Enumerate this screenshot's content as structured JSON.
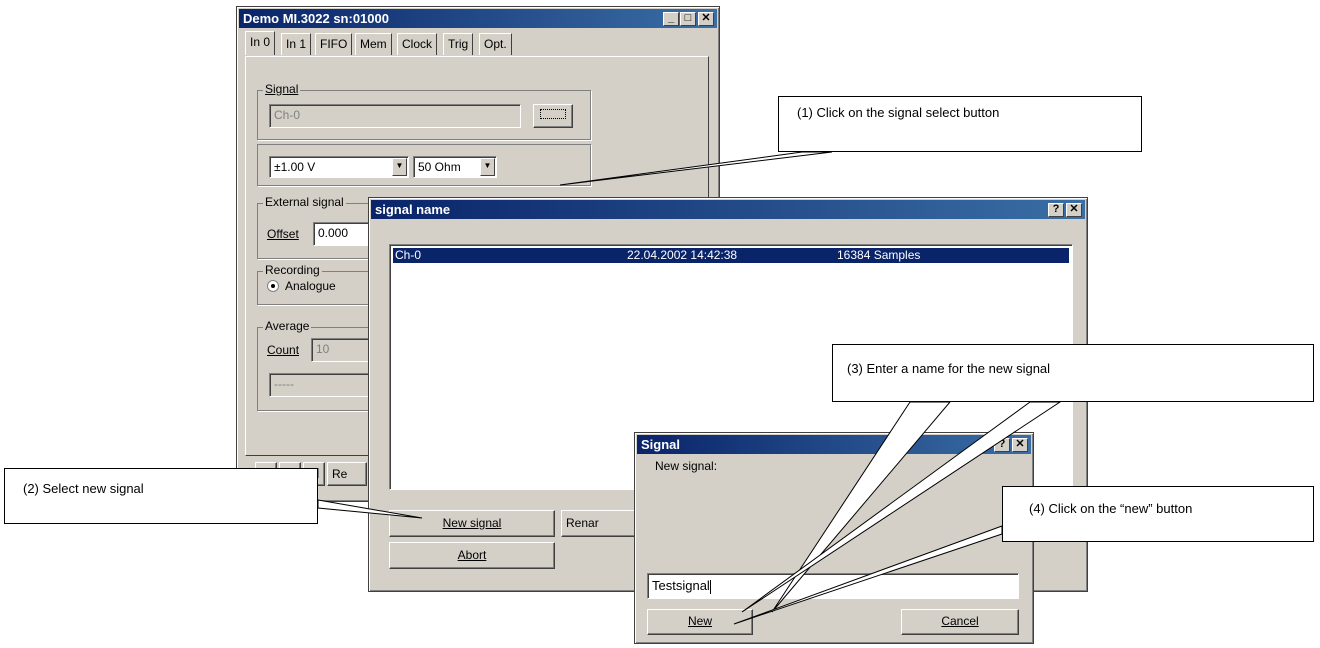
{
  "main_window": {
    "title": "Demo MI.3022 sn:01000",
    "tabs": [
      "In 0",
      "In 1",
      "FIFO",
      "Mem",
      "Clock",
      "Trig",
      "Opt."
    ],
    "signal_group": "Signal",
    "signal_value": "Ch-0",
    "range_value": "±1.00 V",
    "impedance_value": "50 Ohm",
    "external_group": "External signal",
    "offset_label": "Offset",
    "offset_value": "0.000",
    "recording_group": "Recording",
    "analogue_label": "Analogue",
    "average_group": "Average",
    "count_label": "Count",
    "count_value": "10",
    "dashes_value": "-----",
    "bottom_partial": "Re"
  },
  "signal_name_dialog": {
    "title": "signal name",
    "list": [
      {
        "name": "Ch-0",
        "date": "22.04.2002 14:42:38",
        "samples": "16384 Samples"
      }
    ],
    "new_signal_label": "New signal",
    "rename_label": "Renar",
    "abort_label": "Abort"
  },
  "signal_dialog": {
    "title": "Signal",
    "prompt": "New signal:",
    "input_value": "Testsignal",
    "new_label": "New",
    "cancel_label": "Cancel"
  },
  "callouts": {
    "c1": "(1) Click on the signal select button",
    "c2": "(2) Select new signal",
    "c3": "(3) Enter a name for the new signal",
    "c4": "(4) Click on the “new” button"
  },
  "colors": {
    "titlebar": "#0a246a",
    "face": "#d4d0c8",
    "selection": "#0a246a"
  }
}
